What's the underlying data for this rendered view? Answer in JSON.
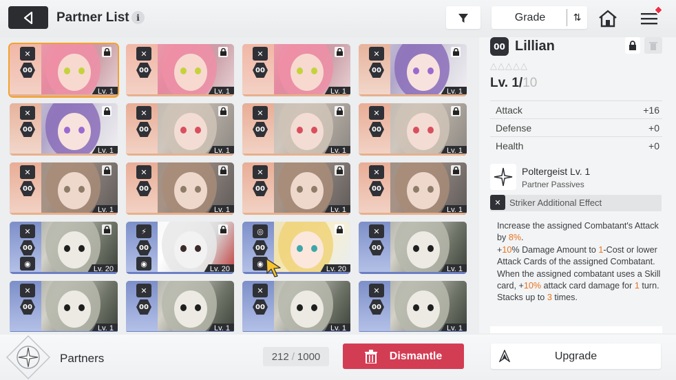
{
  "header": {
    "title": "Partner List",
    "info_icon": "i",
    "grade_label": "Grade",
    "sort_icon": "⇅"
  },
  "cards": [
    {
      "name": "pink-hair-girl",
      "level": "Lv. 1",
      "icon_top": "✕",
      "icon_mid": "00",
      "locked": true,
      "selected": true,
      "theme": "pink"
    },
    {
      "name": "pink-hair-girl",
      "level": "Lv. 1",
      "icon_top": "✕",
      "icon_mid": "00",
      "locked": true,
      "theme": "pink"
    },
    {
      "name": "pink-hair-girl",
      "level": "Lv. 1",
      "icon_top": "✕",
      "icon_mid": "00",
      "locked": true,
      "theme": "pink"
    },
    {
      "name": "purple-hair-girl",
      "level": "Lv. 1",
      "icon_top": "✕",
      "icon_mid": "00",
      "locked": true,
      "theme": "purple"
    },
    {
      "name": "purple-hair-girl",
      "level": "Lv. 1",
      "icon_top": "✕",
      "icon_mid": "00",
      "locked": true,
      "theme": "purple"
    },
    {
      "name": "grey-hair-girl",
      "level": "Lv. 1",
      "icon_top": "✕",
      "icon_mid": "00",
      "locked": true,
      "theme": "grey"
    },
    {
      "name": "grey-hair-girl",
      "level": "Lv. 1",
      "icon_top": "✕",
      "icon_mid": "00",
      "locked": true,
      "theme": "grey"
    },
    {
      "name": "grey-hair-girl",
      "level": "Lv. 1",
      "icon_top": "✕",
      "icon_mid": "00",
      "locked": true,
      "theme": "grey"
    },
    {
      "name": "brown-hair-girl",
      "level": "Lv. 1",
      "icon_top": "✕",
      "icon_mid": "00",
      "locked": true,
      "theme": "brown"
    },
    {
      "name": "brown-hair-girl",
      "level": "Lv. 1",
      "icon_top": "✕",
      "icon_mid": "00",
      "locked": true,
      "theme": "brown"
    },
    {
      "name": "brown-hair-girl",
      "level": "Lv. 1",
      "icon_top": "✕",
      "icon_mid": "00",
      "locked": true,
      "theme": "brown"
    },
    {
      "name": "brown-hair-girl",
      "level": "Lv. 1",
      "icon_top": "✕",
      "icon_mid": "00",
      "locked": true,
      "theme": "brown"
    },
    {
      "name": "white-mask-creature",
      "level": "Lv. 20",
      "icon_top": "✕",
      "icon_mid": "00",
      "icon_bot": "◉",
      "locked": true,
      "theme": "blue"
    },
    {
      "name": "white-fox",
      "level": "Lv. 20",
      "icon_top": "⚡",
      "icon_mid": "00",
      "icon_bot": "◉",
      "locked": true,
      "theme": "fox"
    },
    {
      "name": "blonde-girl",
      "level": "Lv. 20",
      "icon_top": "◎",
      "icon_mid": "00",
      "icon_bot": "◉",
      "locked": true,
      "theme": "blonde"
    },
    {
      "name": "white-mask-creature",
      "level": "Lv. 1",
      "icon_top": "✕",
      "icon_mid": "00",
      "locked": false,
      "theme": "blue"
    },
    {
      "name": "white-mask-creature",
      "level": "Lv. 1",
      "icon_top": "✕",
      "icon_mid": "00",
      "locked": false,
      "theme": "blue"
    },
    {
      "name": "white-mask-creature",
      "level": "Lv. 1",
      "icon_top": "✕",
      "icon_mid": "00",
      "locked": false,
      "theme": "blue"
    },
    {
      "name": "white-mask-creature",
      "level": "Lv. 1",
      "icon_top": "✕",
      "icon_mid": "00",
      "locked": false,
      "theme": "blue"
    },
    {
      "name": "white-mask-creature",
      "level": "Lv. 1",
      "icon_top": "✕",
      "icon_mid": "00",
      "locked": false,
      "theme": "blue"
    }
  ],
  "detail": {
    "icon": "00",
    "name": "Lillian",
    "stars": "△△△△△",
    "level_current": "Lv. 1/",
    "level_max": "10",
    "stats": [
      {
        "label": "Attack",
        "value": "+16"
      },
      {
        "label": "Defense",
        "value": "+0"
      },
      {
        "label": "Health",
        "value": "+0"
      }
    ],
    "passive_name": "Poltergeist Lv. 1",
    "passive_sub": "Partner Passives",
    "effect_label": "Striker Additional Effect",
    "desc": [
      {
        "t": "Increase the assigned Combatant's Attack by "
      },
      {
        "t": "8%",
        "h": true
      },
      {
        "t": ".\n+"
      },
      {
        "t": "10",
        "h": true
      },
      {
        "t": "% Damage Amount to "
      },
      {
        "t": "1",
        "h": true
      },
      {
        "t": "-Cost or lower Attack Cards of the assigned Combatant.\nWhen the assigned combatant uses a Skill card, +"
      },
      {
        "t": "10%",
        "h": true
      },
      {
        "t": " attack card damage for "
      },
      {
        "t": "1",
        "h": true
      },
      {
        "t": " turn. Stacks up to "
      },
      {
        "t": "3",
        "h": true
      },
      {
        "t": " times."
      }
    ]
  },
  "footer": {
    "partners_label": "Partners",
    "count_current": "212",
    "count_sep": "/",
    "count_max": "1000",
    "dismantle_label": "Dismantle",
    "upgrade_label": "Upgrade"
  },
  "colors": {
    "accent": "#f2a22d",
    "dismantle": "#d33d54",
    "dark": "#2b2d31",
    "highlight": "#e8721c"
  }
}
